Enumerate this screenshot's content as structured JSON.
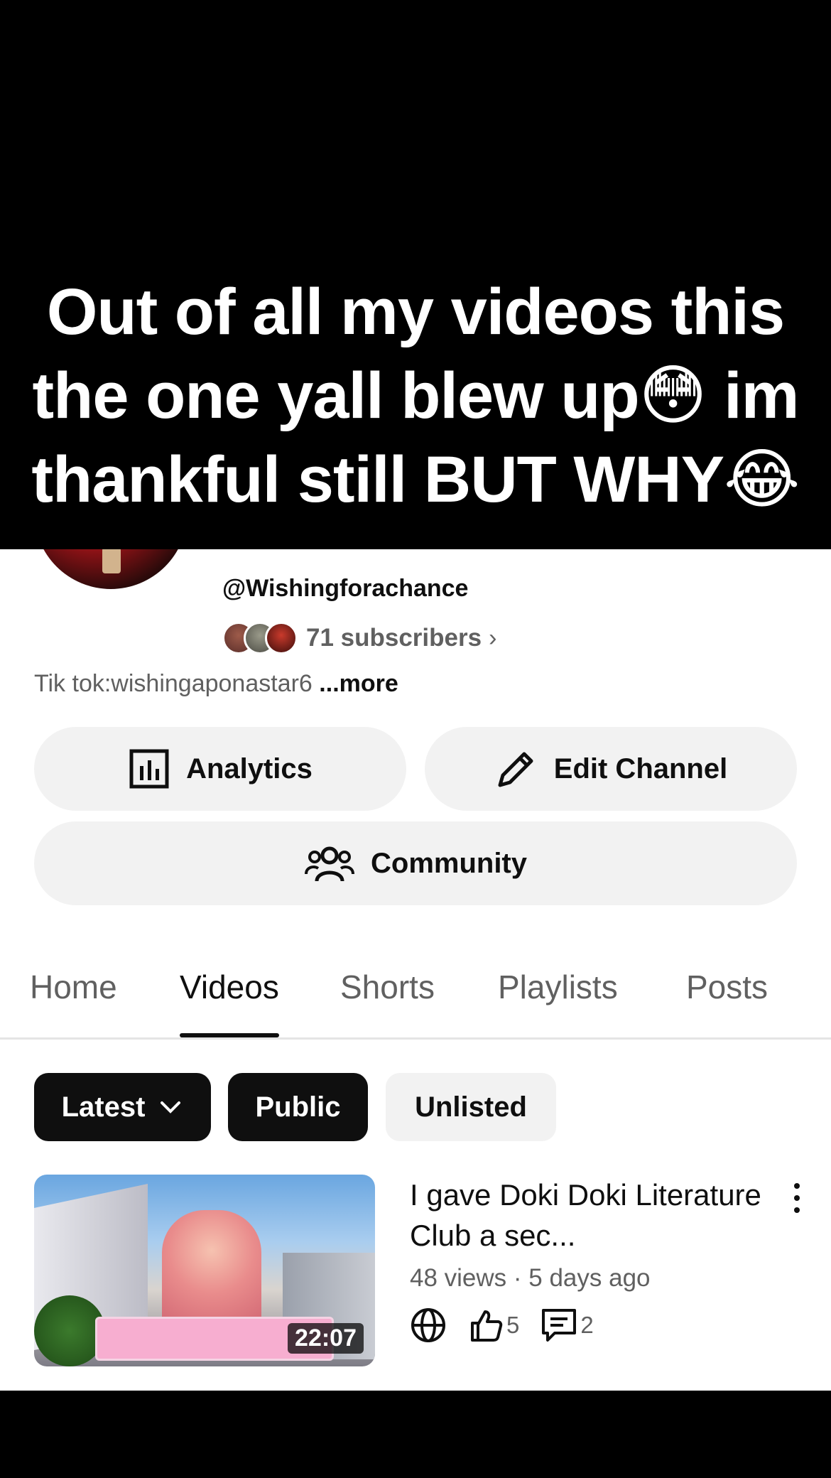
{
  "caption": {
    "text": "Out of all my videos this the one yall blew up😳 im thankful still BUT WHY😂"
  },
  "channel": {
    "handle": "@Wishingforachance",
    "subscribers": "71 subscribers",
    "bio": "Tik tok:wishingaponastar6",
    "more_label": "...more"
  },
  "actions": {
    "analytics_label": "Analytics",
    "edit_label": "Edit Channel",
    "community_label": "Community"
  },
  "tabs": [
    {
      "label": "Home"
    },
    {
      "label": "Videos",
      "active": true
    },
    {
      "label": "Shorts"
    },
    {
      "label": "Playlists"
    },
    {
      "label": "Posts"
    }
  ],
  "filters": {
    "sort_label": "Latest",
    "public_label": "Public",
    "unlisted_label": "Unlisted"
  },
  "video": {
    "title": "I gave Doki Doki Literature Club a sec...",
    "duration": "22:07",
    "meta": "48 views · 5 days ago",
    "likes": "5",
    "comments": "2",
    "visibility_icon": "globe-icon"
  },
  "colors": {
    "text_primary": "#0f0f0f",
    "text_secondary": "#606060",
    "pill_bg": "#f2f2f2"
  }
}
